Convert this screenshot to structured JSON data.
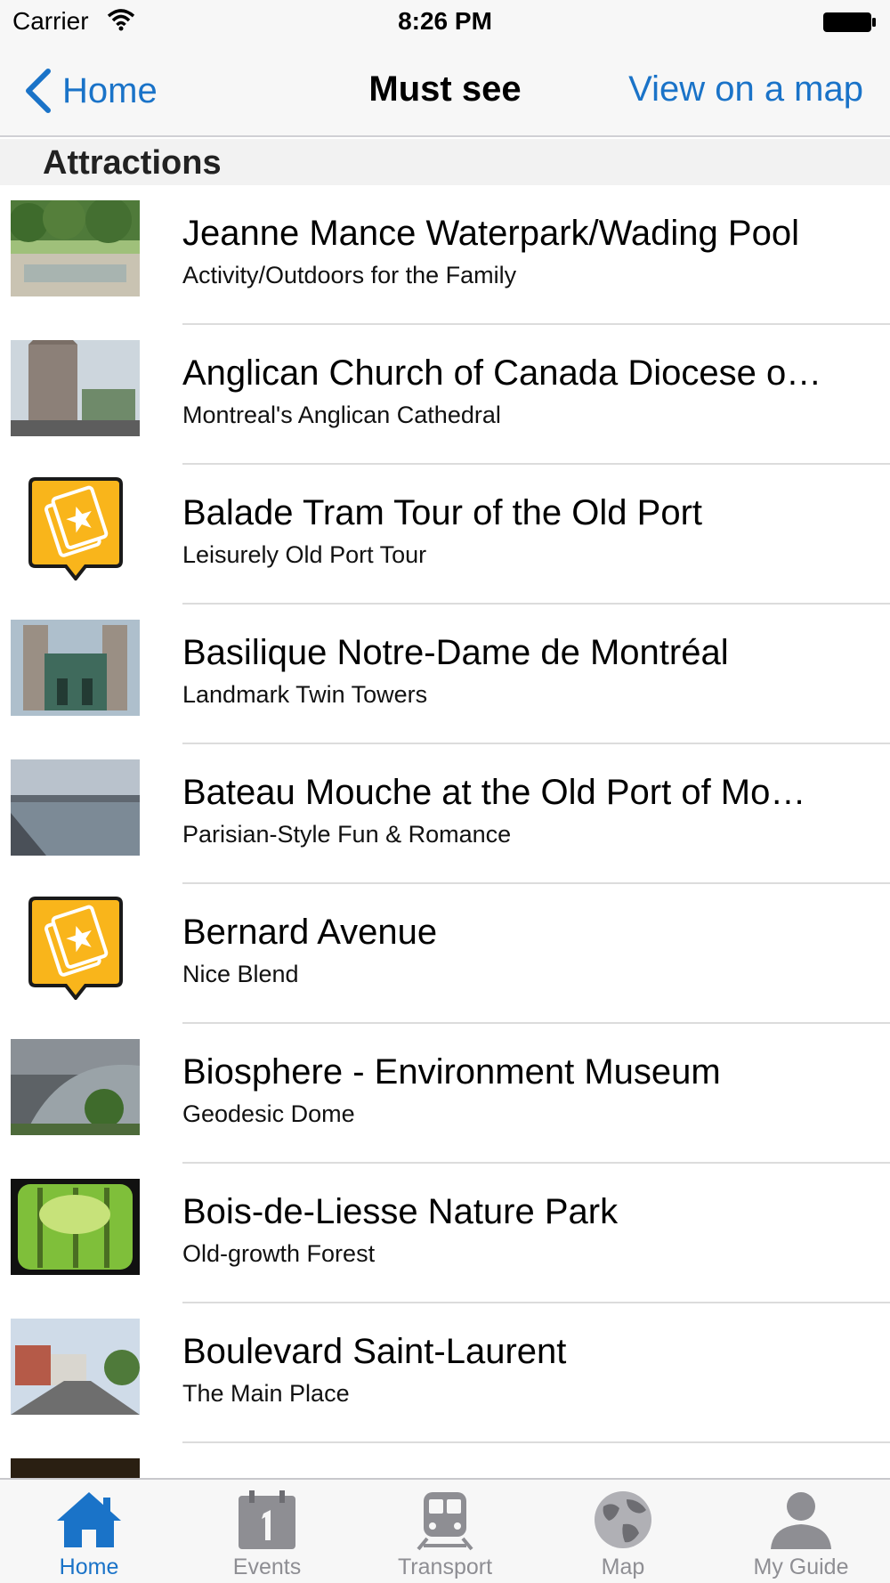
{
  "status": {
    "carrier": "Carrier",
    "time": "8:26 PM"
  },
  "nav": {
    "back_label": "Home",
    "title": "Must see",
    "right_action": "View on a map"
  },
  "section": {
    "title": "Attractions"
  },
  "items": [
    {
      "title": " Jeanne Mance Waterpark/Wading Pool",
      "subtitle": "Activity/Outdoors for the Family",
      "thumb": "photo"
    },
    {
      "title": "Anglican Church of Canada Diocese o…",
      "subtitle": "Montreal's Anglican Cathedral",
      "thumb": "photo"
    },
    {
      "title": "Balade Tram Tour of the Old Port",
      "subtitle": "Leisurely Old Port Tour",
      "thumb": "ticket-pin-icon"
    },
    {
      "title": "Basilique Notre-Dame de Montréal",
      "subtitle": "Landmark Twin Towers",
      "thumb": "photo"
    },
    {
      "title": "Bateau Mouche at the Old Port of Mo…",
      "subtitle": "Parisian-Style Fun & Romance",
      "thumb": "photo"
    },
    {
      "title": "Bernard Avenue",
      "subtitle": "Nice Blend",
      "thumb": "ticket-pin-icon"
    },
    {
      "title": "Biosphere - Environment Museum",
      "subtitle": "Geodesic Dome",
      "thumb": "photo"
    },
    {
      "title": "Bois-de-Liesse Nature Park",
      "subtitle": "Old-growth Forest",
      "thumb": "photo"
    },
    {
      "title": "Boulevard Saint-Laurent",
      "subtitle": "The Main Place",
      "thumb": "photo"
    }
  ],
  "tabs": [
    {
      "label": "Home",
      "icon": "house-icon",
      "active": true
    },
    {
      "label": "Events",
      "icon": "calendar-icon",
      "active": false
    },
    {
      "label": "Transport",
      "icon": "train-icon",
      "active": false
    },
    {
      "label": "Map",
      "icon": "globe-icon",
      "active": false
    },
    {
      "label": "My Guide",
      "icon": "person-icon",
      "active": false
    }
  ],
  "colors": {
    "accent": "#1a73c8",
    "pin_fill": "#f9b51b",
    "inactive": "#8e8e93"
  }
}
